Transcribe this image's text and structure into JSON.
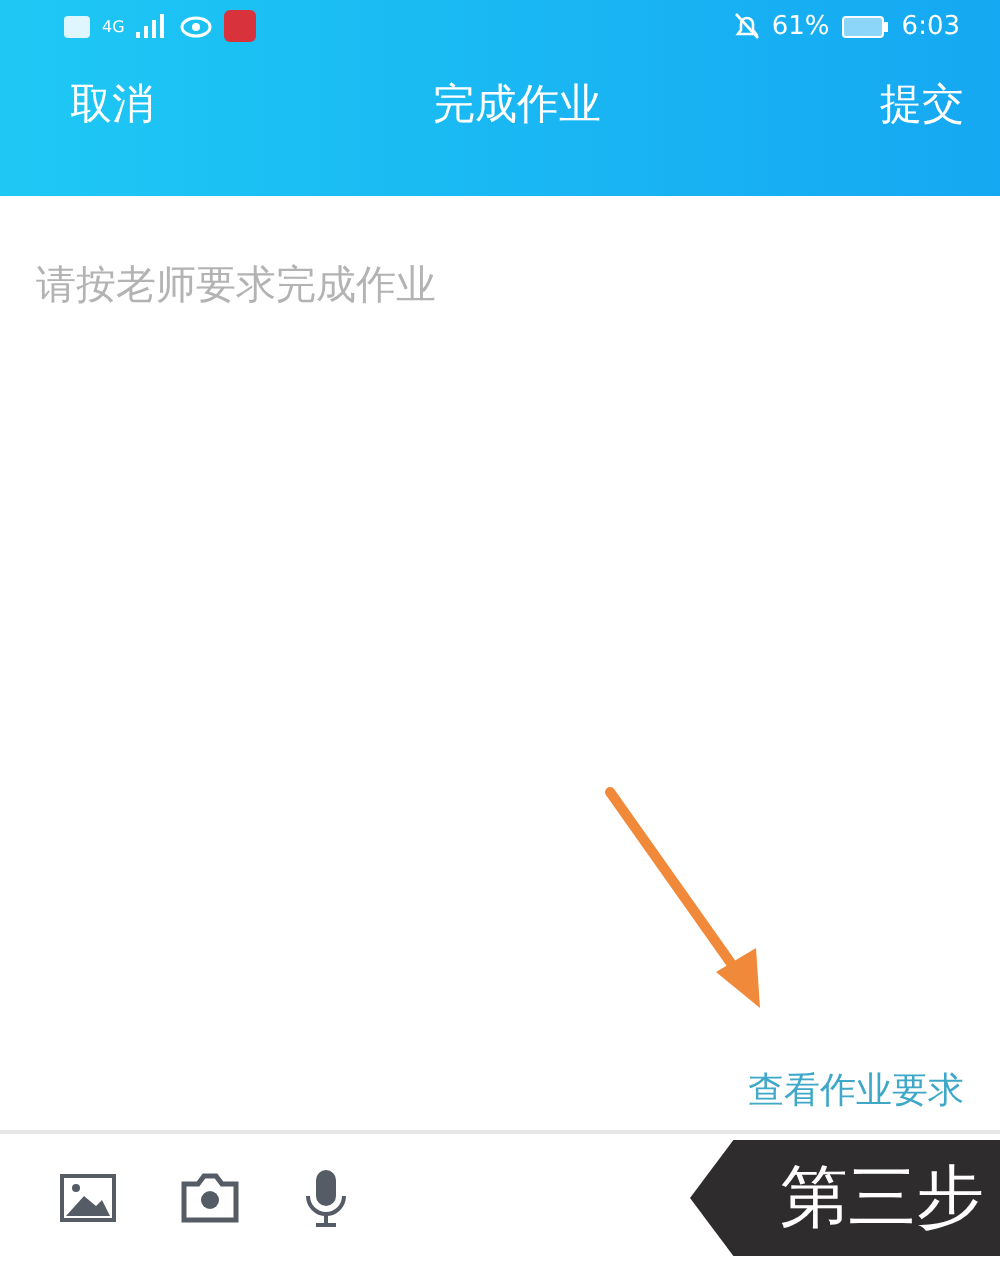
{
  "status_bar": {
    "signal_label": "4G",
    "battery": "61%",
    "time": "6:03"
  },
  "header": {
    "cancel": "取消",
    "title": "完成作业",
    "submit": "提交"
  },
  "editor": {
    "placeholder": "请按老师要求完成作业"
  },
  "requirements_link": "查看作业要求",
  "annotation": {
    "step_label": "第三步"
  }
}
